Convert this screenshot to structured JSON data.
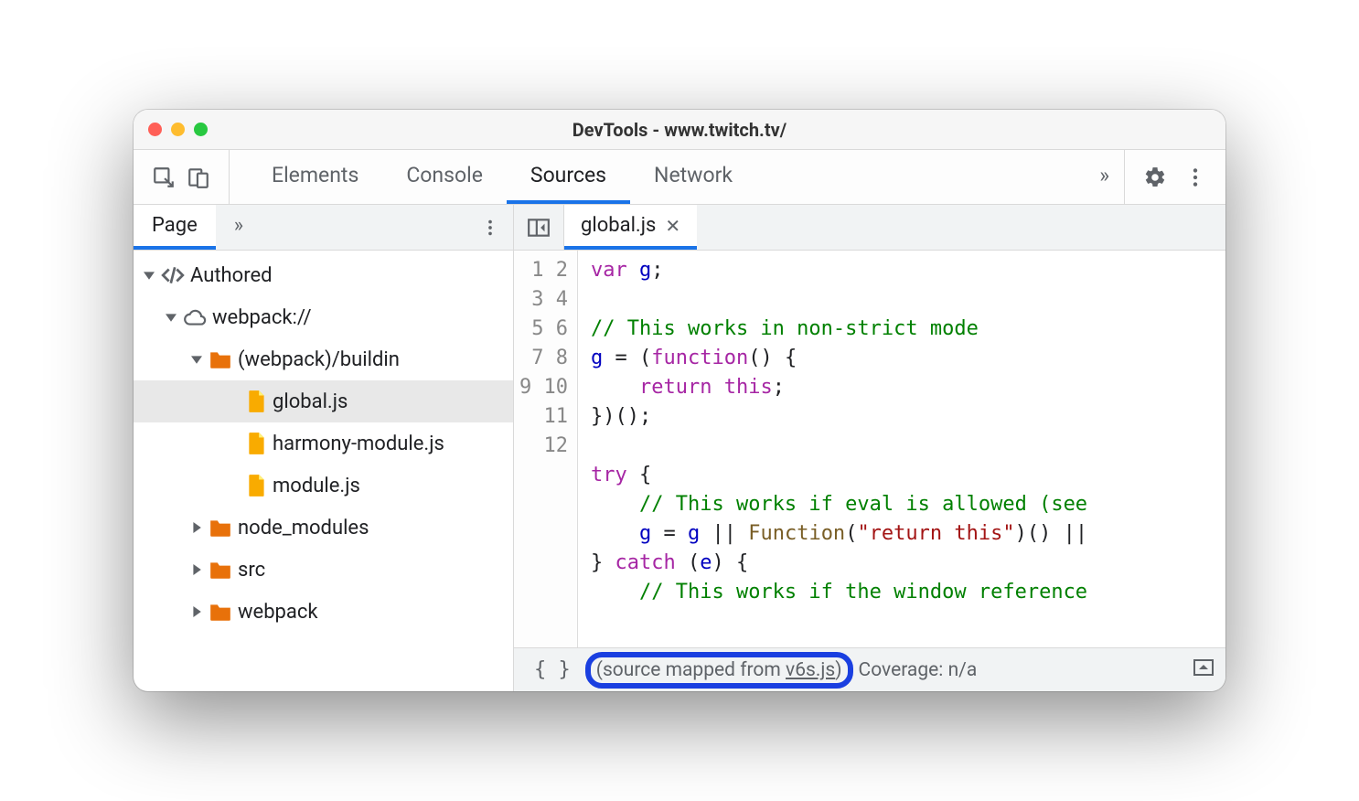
{
  "window": {
    "title": "DevTools - www.twitch.tv/"
  },
  "toolbar": {
    "tabs": [
      "Elements",
      "Console",
      "Sources",
      "Network"
    ],
    "active_index": 2,
    "more_glyph": "»"
  },
  "sidebar": {
    "tabs": {
      "page": "Page",
      "more_glyph": "»"
    },
    "tree": {
      "root": "Authored",
      "domain": "webpack://",
      "folder_buildin": "(webpack)/buildin",
      "files": [
        "global.js",
        "harmony-module.js",
        "module.js"
      ],
      "folders_collapsed": [
        "node_modules",
        "src",
        "webpack"
      ],
      "selected_file_index": 0
    }
  },
  "editor": {
    "open_file": "global.js",
    "line_count": 12,
    "code_lines": [
      {
        "type": "code",
        "html": "<span class='tok-kw'>var</span> <span class='tok-var'>g</span>;"
      },
      {
        "type": "blank",
        "html": ""
      },
      {
        "type": "comment",
        "html": "<span class='tok-comment'>// This works in non-strict mode</span>"
      },
      {
        "type": "code",
        "html": "<span class='tok-var'>g</span> = (<span class='tok-kw'>function</span>() {"
      },
      {
        "type": "code",
        "html": "    <span class='tok-kw'>return</span> <span class='tok-kw'>this</span>;"
      },
      {
        "type": "code",
        "html": "})();"
      },
      {
        "type": "blank",
        "html": ""
      },
      {
        "type": "code",
        "html": "<span class='tok-kw'>try</span> {"
      },
      {
        "type": "comment",
        "html": "    <span class='tok-comment'>// This works if eval is allowed (see </span>"
      },
      {
        "type": "code",
        "html": "    <span class='tok-var'>g</span> = <span class='tok-var'>g</span> || <span class='tok-fn'>Function</span>(<span class='tok-str'>\"return this\"</span>)() || "
      },
      {
        "type": "code",
        "html": "} <span class='tok-kw'>catch</span> (<span class='tok-var'>e</span>) {"
      },
      {
        "type": "comment",
        "html": "    <span class='tok-comment'>// This works if the window reference</span>"
      }
    ]
  },
  "statusbar": {
    "pretty_glyph": "{ }",
    "mapped_prefix": "(source mapped from ",
    "mapped_link": "v6s.js",
    "mapped_suffix": ")",
    "coverage": "Coverage: n/a"
  }
}
